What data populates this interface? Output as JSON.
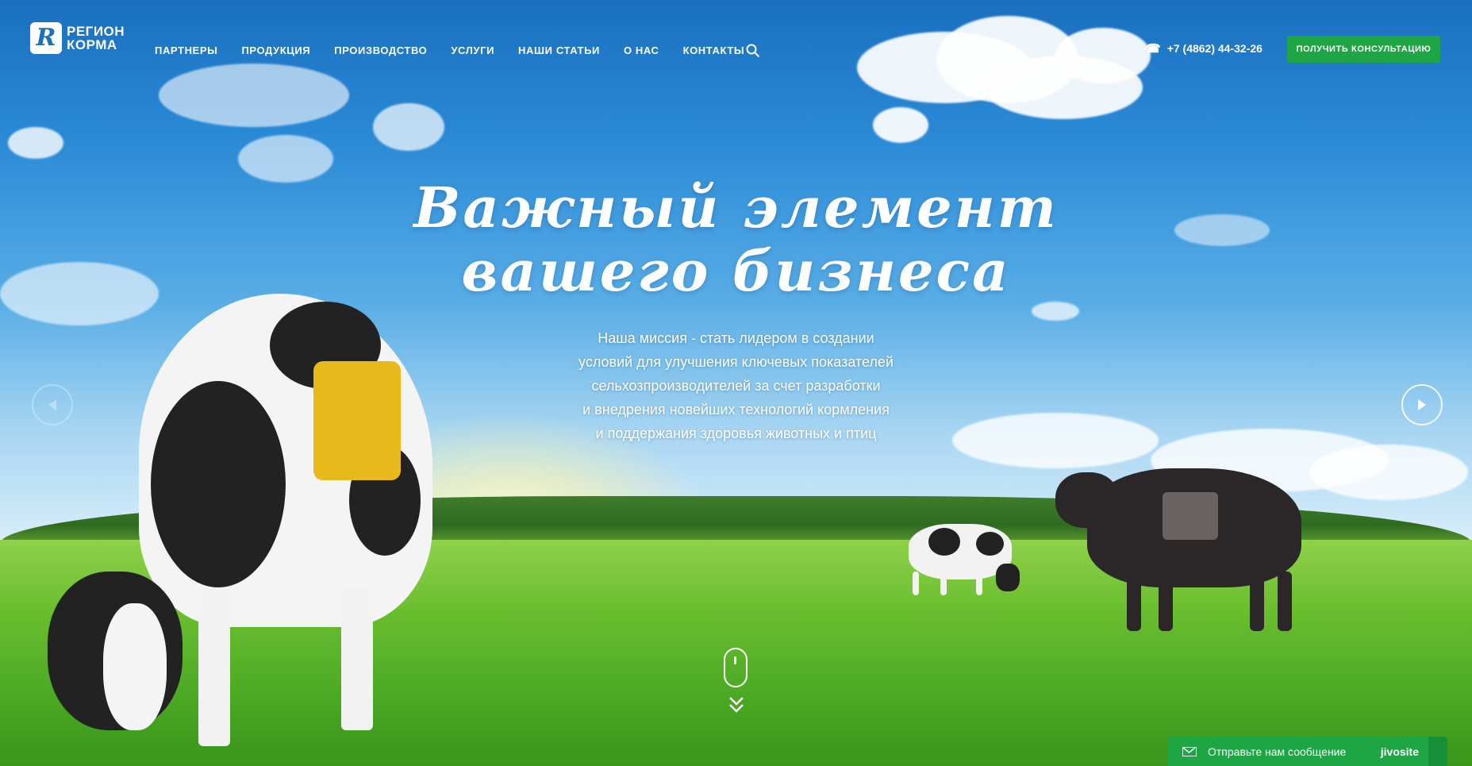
{
  "header": {
    "logo_line1": "РЕГИОН",
    "logo_line2": "КОРМА",
    "logo_mark": "R",
    "nav": [
      {
        "label": "ПАРТНЕРЫ"
      },
      {
        "label": "ПРОДУКЦИЯ"
      },
      {
        "label": "ПРОИЗВОДСТВО"
      },
      {
        "label": "УСЛУГИ"
      },
      {
        "label": "НАШИ СТАТЬИ"
      },
      {
        "label": "О НАС"
      },
      {
        "label": "КОНТАКТЫ"
      }
    ],
    "search_icon": "search-icon",
    "phone": "+7 (4862) 44-32-26",
    "cta_label": "ПОЛУЧИТЬ КОНСУЛЬТАЦИЮ"
  },
  "hero": {
    "headline_line1": "Важный элемент",
    "headline_line2": "вашего бизнеса",
    "mission_lines": [
      "Наша миссия - стать лидером в создании",
      "условий для улучшения ключевых показателей",
      "сельхозпроизводителей за счет разработки",
      "и внедрения новейших технологий кормления",
      "и поддержания здоровья животных и птиц"
    ]
  },
  "chat": {
    "label": "Отправьте нам сообщение",
    "brand": "jivosite"
  },
  "colors": {
    "accent_green": "#1da643",
    "sky_blue": "#2a86cf"
  }
}
